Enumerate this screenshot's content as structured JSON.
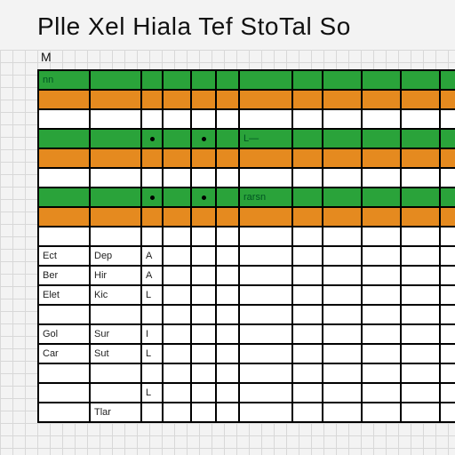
{
  "title": "Plle Xel Hiala Tef StoTal So",
  "col_header": "M",
  "rows": [
    {
      "type": "green",
      "c0": "nn",
      "c6": ""
    },
    {
      "type": "orange",
      "c0": "",
      "c6": ""
    },
    {
      "type": "white",
      "c0": "",
      "c6": ""
    },
    {
      "type": "green",
      "c0": "",
      "c2dot": true,
      "c4dot": true,
      "c6": "L—"
    },
    {
      "type": "orange",
      "c0": "",
      "c6": ""
    },
    {
      "type": "white",
      "c0": "",
      "c6": ""
    },
    {
      "type": "green",
      "c0": "",
      "c2dot": true,
      "c4dot": true,
      "c6": "rarsn"
    },
    {
      "type": "orange",
      "c0": "",
      "c6": ""
    },
    {
      "type": "white",
      "c0": "",
      "c6": ""
    }
  ],
  "labels": [
    {
      "a": "Ect",
      "b": "Dep",
      "c": "A"
    },
    {
      "a": "Ber",
      "b": "Hir",
      "c": "A"
    },
    {
      "a": "Elet",
      "b": "Kic",
      "c": "L"
    },
    {
      "a": "",
      "b": "",
      "c": ""
    },
    {
      "a": "Gol",
      "b": "Sur",
      "c": "I"
    },
    {
      "a": "Car",
      "b": "Sut",
      "c": "L"
    },
    {
      "a": "",
      "b": "",
      "c": ""
    },
    {
      "a": "",
      "b": "",
      "c": "L"
    },
    {
      "a": "",
      "b": "Tlar",
      "c": ""
    }
  ]
}
